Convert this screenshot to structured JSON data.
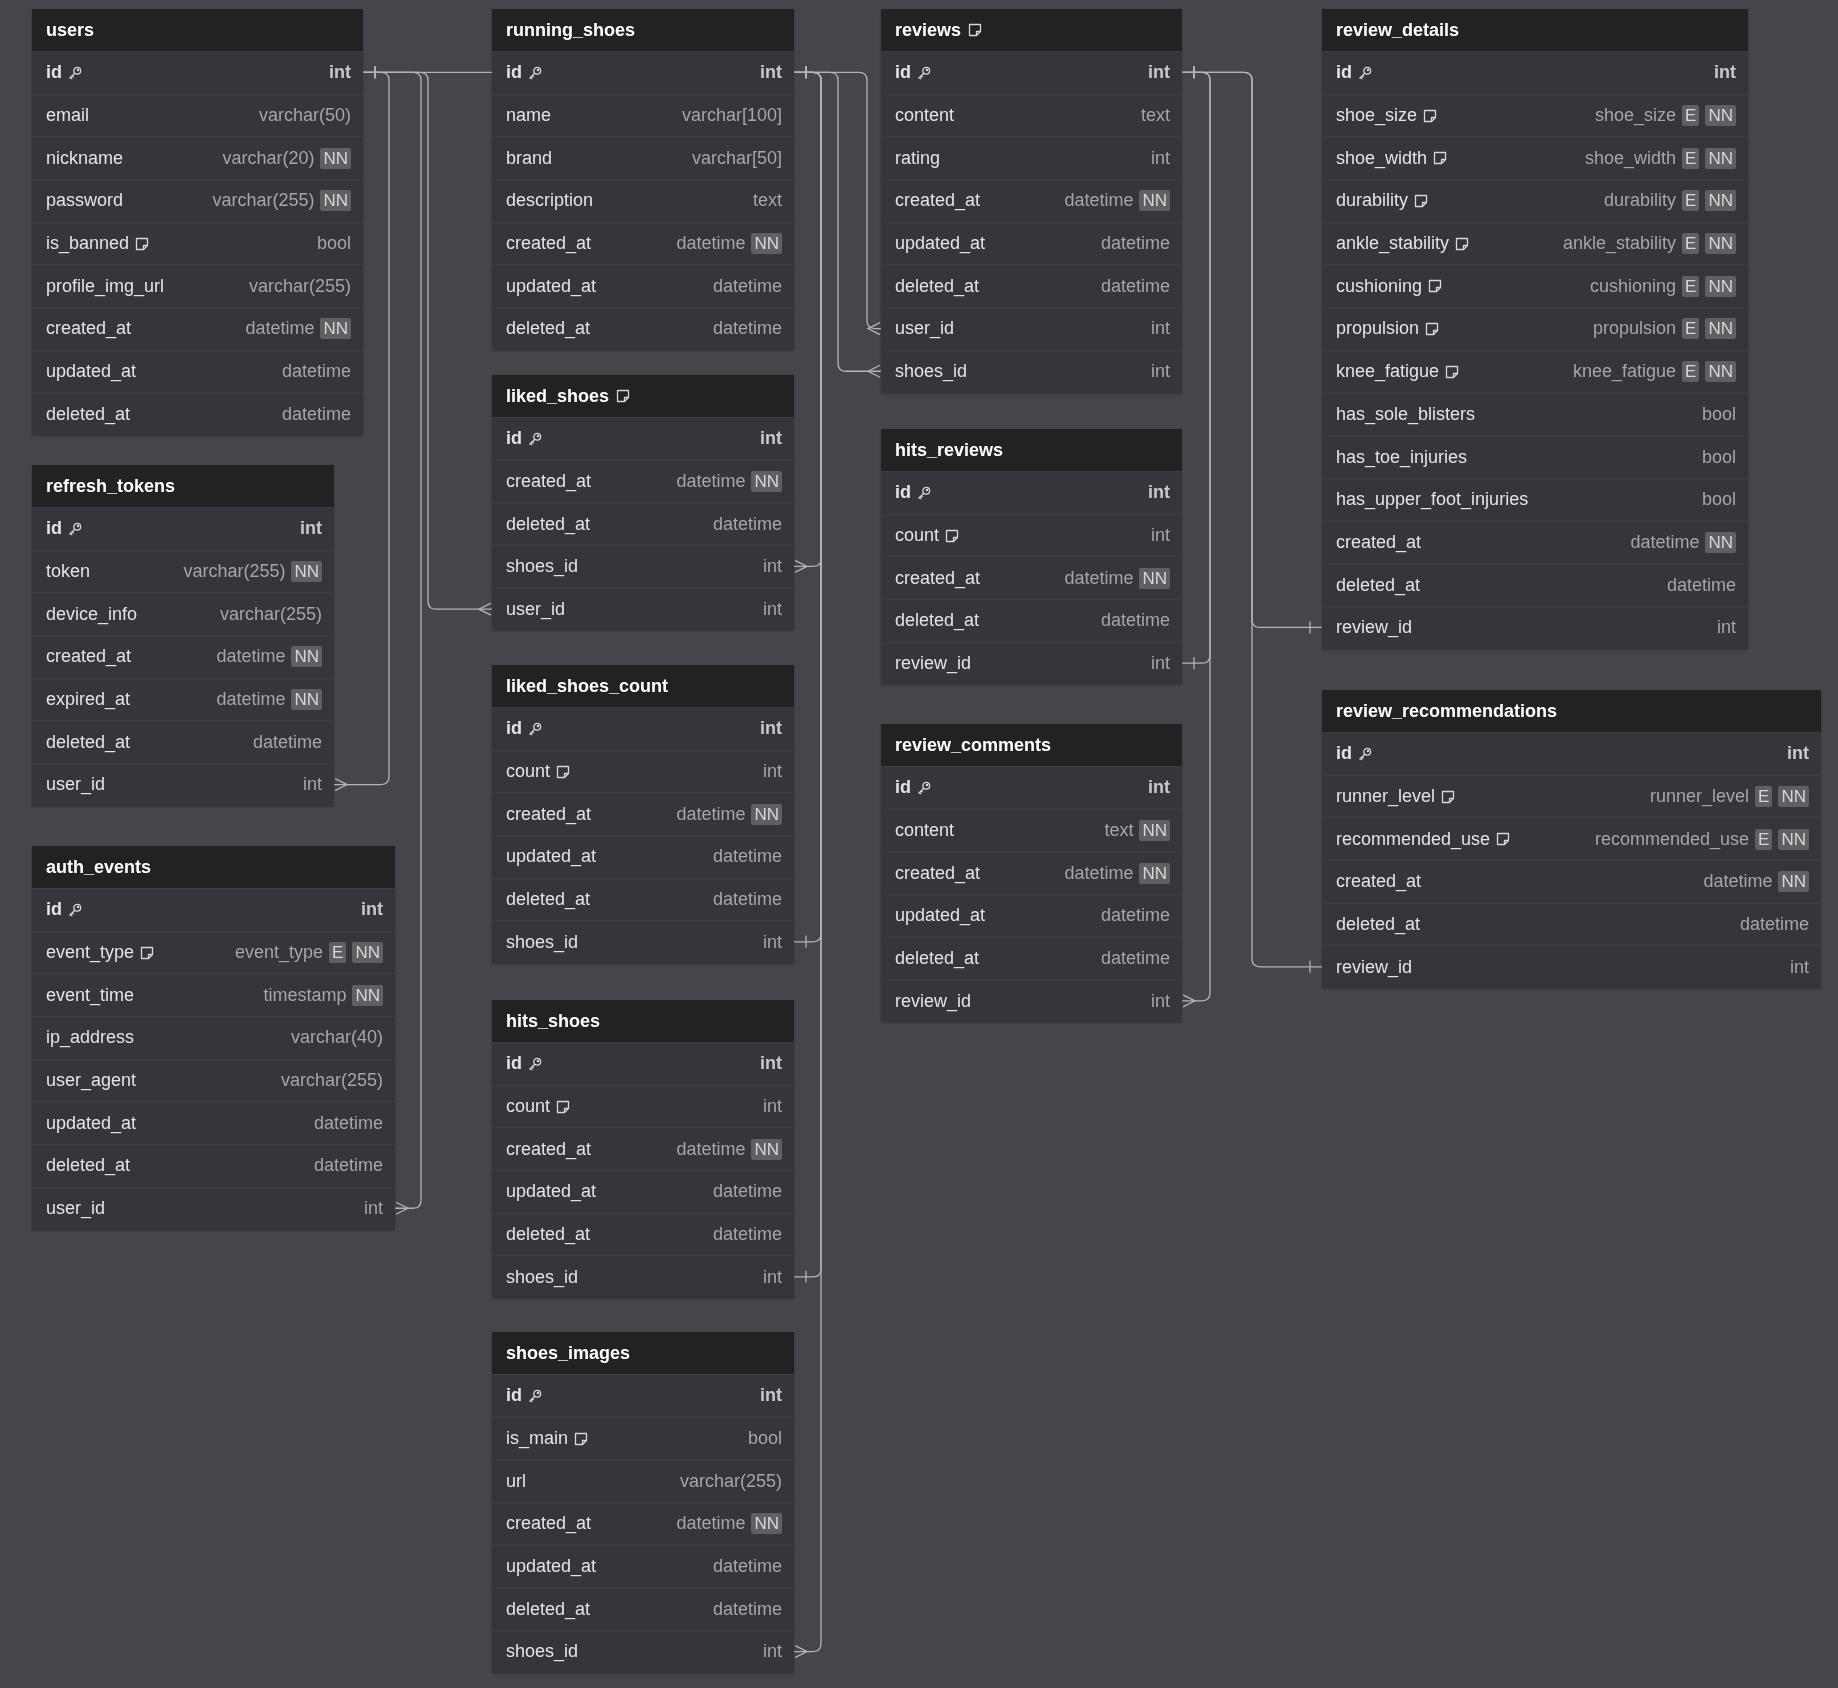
{
  "tables": [
    {
      "name": "users",
      "note": false,
      "columns": [
        {
          "name": "id",
          "type": "int",
          "primary_key": true,
          "note": false
        },
        {
          "name": "email",
          "type": "varchar(50)",
          "primary_key": false,
          "note": false
        },
        {
          "name": "nickname",
          "type": "varchar(20)",
          "primary_key": false,
          "note": false,
          "badges": [
            "NN"
          ]
        },
        {
          "name": "password",
          "type": "varchar(255)",
          "primary_key": false,
          "note": false,
          "badges": [
            "NN"
          ]
        },
        {
          "name": "is_banned",
          "type": "bool",
          "primary_key": false,
          "note": true
        },
        {
          "name": "profile_img_url",
          "type": "varchar(255)",
          "primary_key": false,
          "note": false
        },
        {
          "name": "created_at",
          "type": "datetime",
          "primary_key": false,
          "note": false,
          "badges": [
            "NN"
          ]
        },
        {
          "name": "updated_at",
          "type": "datetime",
          "primary_key": false,
          "note": false
        },
        {
          "name": "deleted_at",
          "type": "datetime",
          "primary_key": false,
          "note": false
        }
      ]
    },
    {
      "name": "refresh_tokens",
      "note": false,
      "columns": [
        {
          "name": "id",
          "type": "int",
          "primary_key": true,
          "note": false
        },
        {
          "name": "token",
          "type": "varchar(255)",
          "primary_key": false,
          "note": false,
          "badges": [
            "NN"
          ]
        },
        {
          "name": "device_info",
          "type": "varchar(255)",
          "primary_key": false,
          "note": false
        },
        {
          "name": "created_at",
          "type": "datetime",
          "primary_key": false,
          "note": false,
          "badges": [
            "NN"
          ]
        },
        {
          "name": "expired_at",
          "type": "datetime",
          "primary_key": false,
          "note": false,
          "badges": [
            "NN"
          ]
        },
        {
          "name": "deleted_at",
          "type": "datetime",
          "primary_key": false,
          "note": false
        },
        {
          "name": "user_id",
          "type": "int",
          "primary_key": false,
          "note": false
        }
      ]
    },
    {
      "name": "auth_events",
      "note": false,
      "columns": [
        {
          "name": "id",
          "type": "int",
          "primary_key": true,
          "note": false
        },
        {
          "name": "event_type",
          "type": "event_type",
          "primary_key": false,
          "note": true,
          "badges": [
            "E",
            "NN"
          ]
        },
        {
          "name": "event_time",
          "type": "timestamp",
          "primary_key": false,
          "note": false,
          "badges": [
            "NN"
          ]
        },
        {
          "name": "ip_address",
          "type": "varchar(40)",
          "primary_key": false,
          "note": false
        },
        {
          "name": "user_agent",
          "type": "varchar(255)",
          "primary_key": false,
          "note": false
        },
        {
          "name": "updated_at",
          "type": "datetime",
          "primary_key": false,
          "note": false
        },
        {
          "name": "deleted_at",
          "type": "datetime",
          "primary_key": false,
          "note": false
        },
        {
          "name": "user_id",
          "type": "int",
          "primary_key": false,
          "note": false
        }
      ]
    },
    {
      "name": "running_shoes",
      "note": false,
      "columns": [
        {
          "name": "id",
          "type": "int",
          "primary_key": true,
          "note": false
        },
        {
          "name": "name",
          "type": "varchar[100]",
          "primary_key": false,
          "note": false
        },
        {
          "name": "brand",
          "type": "varchar[50]",
          "primary_key": false,
          "note": false
        },
        {
          "name": "description",
          "type": "text",
          "primary_key": false,
          "note": false
        },
        {
          "name": "created_at",
          "type": "datetime",
          "primary_key": false,
          "note": false,
          "badges": [
            "NN"
          ]
        },
        {
          "name": "updated_at",
          "type": "datetime",
          "primary_key": false,
          "note": false
        },
        {
          "name": "deleted_at",
          "type": "datetime",
          "primary_key": false,
          "note": false
        }
      ]
    },
    {
      "name": "liked_shoes",
      "note": true,
      "columns": [
        {
          "name": "id",
          "type": "int",
          "primary_key": true,
          "note": false
        },
        {
          "name": "created_at",
          "type": "datetime",
          "primary_key": false,
          "note": false,
          "badges": [
            "NN"
          ]
        },
        {
          "name": "deleted_at",
          "type": "datetime",
          "primary_key": false,
          "note": false
        },
        {
          "name": "shoes_id",
          "type": "int",
          "primary_key": false,
          "note": false
        },
        {
          "name": "user_id",
          "type": "int",
          "primary_key": false,
          "note": false
        }
      ]
    },
    {
      "name": "liked_shoes_count",
      "note": false,
      "columns": [
        {
          "name": "id",
          "type": "int",
          "primary_key": true,
          "note": false
        },
        {
          "name": "count",
          "type": "int",
          "primary_key": false,
          "note": true
        },
        {
          "name": "created_at",
          "type": "datetime",
          "primary_key": false,
          "note": false,
          "badges": [
            "NN"
          ]
        },
        {
          "name": "updated_at",
          "type": "datetime",
          "primary_key": false,
          "note": false
        },
        {
          "name": "deleted_at",
          "type": "datetime",
          "primary_key": false,
          "note": false
        },
        {
          "name": "shoes_id",
          "type": "int",
          "primary_key": false,
          "note": false
        }
      ]
    },
    {
      "name": "hits_shoes",
      "note": false,
      "columns": [
        {
          "name": "id",
          "type": "int",
          "primary_key": true,
          "note": false
        },
        {
          "name": "count",
          "type": "int",
          "primary_key": false,
          "note": true
        },
        {
          "name": "created_at",
          "type": "datetime",
          "primary_key": false,
          "note": false,
          "badges": [
            "NN"
          ]
        },
        {
          "name": "updated_at",
          "type": "datetime",
          "primary_key": false,
          "note": false
        },
        {
          "name": "deleted_at",
          "type": "datetime",
          "primary_key": false,
          "note": false
        },
        {
          "name": "shoes_id",
          "type": "int",
          "primary_key": false,
          "note": false
        }
      ]
    },
    {
      "name": "shoes_images",
      "note": false,
      "columns": [
        {
          "name": "id",
          "type": "int",
          "primary_key": true,
          "note": false
        },
        {
          "name": "is_main",
          "type": "bool",
          "primary_key": false,
          "note": true
        },
        {
          "name": "url",
          "type": "varchar(255)",
          "primary_key": false,
          "note": false
        },
        {
          "name": "created_at",
          "type": "datetime",
          "primary_key": false,
          "note": false,
          "badges": [
            "NN"
          ]
        },
        {
          "name": "updated_at",
          "type": "datetime",
          "primary_key": false,
          "note": false
        },
        {
          "name": "deleted_at",
          "type": "datetime",
          "primary_key": false,
          "note": false
        },
        {
          "name": "shoes_id",
          "type": "int",
          "primary_key": false,
          "note": false
        }
      ]
    },
    {
      "name": "reviews",
      "note": true,
      "columns": [
        {
          "name": "id",
          "type": "int",
          "primary_key": true,
          "note": false
        },
        {
          "name": "content",
          "type": "text",
          "primary_key": false,
          "note": false
        },
        {
          "name": "rating",
          "type": "int",
          "primary_key": false,
          "note": false
        },
        {
          "name": "created_at",
          "type": "datetime",
          "primary_key": false,
          "note": false,
          "badges": [
            "NN"
          ]
        },
        {
          "name": "updated_at",
          "type": "datetime",
          "primary_key": false,
          "note": false
        },
        {
          "name": "deleted_at",
          "type": "datetime",
          "primary_key": false,
          "note": false
        },
        {
          "name": "user_id",
          "type": "int",
          "primary_key": false,
          "note": false
        },
        {
          "name": "shoes_id",
          "type": "int",
          "primary_key": false,
          "note": false
        }
      ]
    },
    {
      "name": "hits_reviews",
      "note": false,
      "columns": [
        {
          "name": "id",
          "type": "int",
          "primary_key": true,
          "note": false
        },
        {
          "name": "count",
          "type": "int",
          "primary_key": false,
          "note": true
        },
        {
          "name": "created_at",
          "type": "datetime",
          "primary_key": false,
          "note": false,
          "badges": [
            "NN"
          ]
        },
        {
          "name": "deleted_at",
          "type": "datetime",
          "primary_key": false,
          "note": false
        },
        {
          "name": "review_id",
          "type": "int",
          "primary_key": false,
          "note": false
        }
      ]
    },
    {
      "name": "review_comments",
      "note": false,
      "columns": [
        {
          "name": "id",
          "type": "int",
          "primary_key": true,
          "note": false
        },
        {
          "name": "content",
          "type": "text",
          "primary_key": false,
          "note": false,
          "badges": [
            "NN"
          ]
        },
        {
          "name": "created_at",
          "type": "datetime",
          "primary_key": false,
          "note": false,
          "badges": [
            "NN"
          ]
        },
        {
          "name": "updated_at",
          "type": "datetime",
          "primary_key": false,
          "note": false
        },
        {
          "name": "deleted_at",
          "type": "datetime",
          "primary_key": false,
          "note": false
        },
        {
          "name": "review_id",
          "type": "int",
          "primary_key": false,
          "note": false
        }
      ]
    },
    {
      "name": "review_details",
      "note": false,
      "columns": [
        {
          "name": "id",
          "type": "int",
          "primary_key": true,
          "note": false
        },
        {
          "name": "shoe_size",
          "type": "shoe_size",
          "primary_key": false,
          "note": true,
          "badges": [
            "E",
            "NN"
          ]
        },
        {
          "name": "shoe_width",
          "type": "shoe_width",
          "primary_key": false,
          "note": true,
          "badges": [
            "E",
            "NN"
          ]
        },
        {
          "name": "durability",
          "type": "durability",
          "primary_key": false,
          "note": true,
          "badges": [
            "E",
            "NN"
          ]
        },
        {
          "name": "ankle_stability",
          "type": "ankle_stability",
          "primary_key": false,
          "note": true,
          "badges": [
            "E",
            "NN"
          ]
        },
        {
          "name": "cushioning",
          "type": "cushioning",
          "primary_key": false,
          "note": true,
          "badges": [
            "E",
            "NN"
          ]
        },
        {
          "name": "propulsion",
          "type": "propulsion",
          "primary_key": false,
          "note": true,
          "badges": [
            "E",
            "NN"
          ]
        },
        {
          "name": "knee_fatigue",
          "type": "knee_fatigue",
          "primary_key": false,
          "note": true,
          "badges": [
            "E",
            "NN"
          ]
        },
        {
          "name": "has_sole_blisters",
          "type": "bool",
          "primary_key": false,
          "note": false
        },
        {
          "name": "has_toe_injuries",
          "type": "bool",
          "primary_key": false,
          "note": false
        },
        {
          "name": "has_upper_foot_injuries",
          "type": "bool",
          "primary_key": false,
          "note": false
        },
        {
          "name": "created_at",
          "type": "datetime",
          "primary_key": false,
          "note": false,
          "badges": [
            "NN"
          ]
        },
        {
          "name": "deleted_at",
          "type": "datetime",
          "primary_key": false,
          "note": false
        },
        {
          "name": "review_id",
          "type": "int",
          "primary_key": false,
          "note": false
        }
      ]
    },
    {
      "name": "review_recommendations",
      "note": false,
      "columns": [
        {
          "name": "id",
          "type": "int",
          "primary_key": true,
          "note": false
        },
        {
          "name": "runner_level",
          "type": "runner_level",
          "primary_key": false,
          "note": true,
          "badges": [
            "E",
            "NN"
          ]
        },
        {
          "name": "recommended_use",
          "type": "recommended_use",
          "primary_key": false,
          "note": true,
          "badges": [
            "E",
            "NN"
          ]
        },
        {
          "name": "created_at",
          "type": "datetime",
          "primary_key": false,
          "note": false,
          "badges": [
            "NN"
          ]
        },
        {
          "name": "deleted_at",
          "type": "datetime",
          "primary_key": false,
          "note": false
        },
        {
          "name": "review_id",
          "type": "int",
          "primary_key": false,
          "note": false
        }
      ]
    }
  ]
}
